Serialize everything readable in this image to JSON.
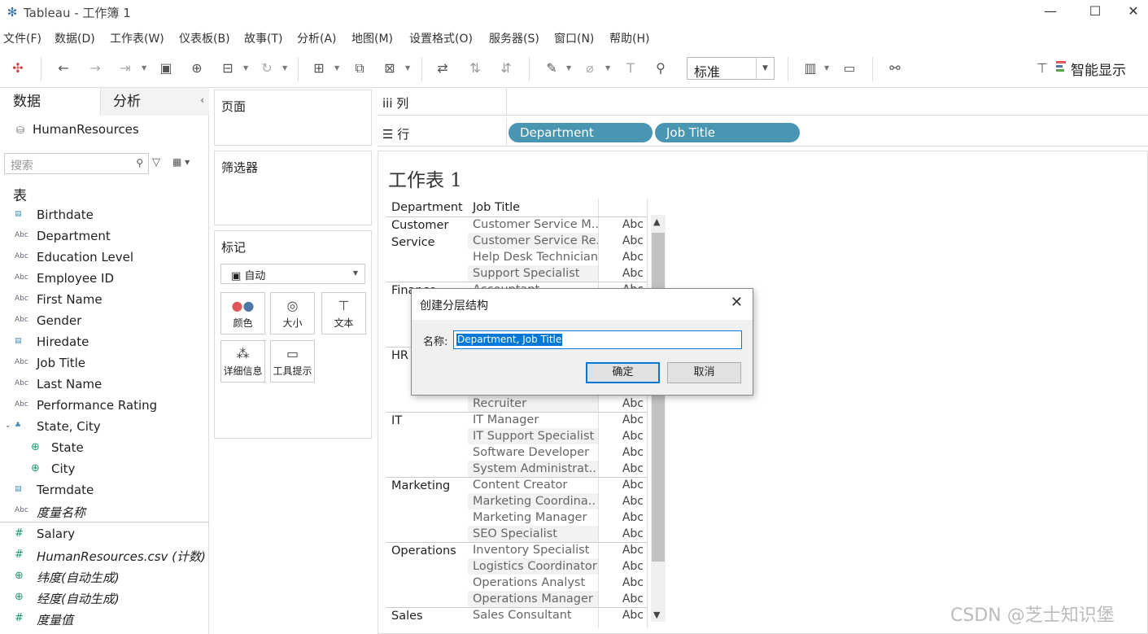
{
  "window": {
    "title": "Tableau - 工作簿 1",
    "minimize": "—",
    "maximize": "☐",
    "close": "✕"
  },
  "menu": [
    "文件(F)",
    "数据(D)",
    "工作表(W)",
    "仪表板(B)",
    "故事(T)",
    "分析(A)",
    "地图(M)",
    "设置格式(O)",
    "服务器(S)",
    "窗口(N)",
    "帮助(H)"
  ],
  "toolbar": {
    "fit_value": "标准",
    "smart_show": "智能显示"
  },
  "left_panel": {
    "tab_data": "数据",
    "tab_analysis": "分析",
    "datasource": "HumanResources",
    "search_placeholder": "搜索",
    "tables_header": "表",
    "fields": [
      {
        "label": "Birthdate",
        "type": "date"
      },
      {
        "label": "Department",
        "type": "string"
      },
      {
        "label": "Education Level",
        "type": "string"
      },
      {
        "label": "Employee ID",
        "type": "string"
      },
      {
        "label": "First Name",
        "type": "string"
      },
      {
        "label": "Gender",
        "type": "string"
      },
      {
        "label": "Hiredate",
        "type": "date"
      },
      {
        "label": "Job Title",
        "type": "string"
      },
      {
        "label": "Last Name",
        "type": "string"
      },
      {
        "label": "Performance Rating",
        "type": "string"
      },
      {
        "label": "State, City",
        "type": "hierarchy"
      },
      {
        "label": "State",
        "type": "geo"
      },
      {
        "label": "City",
        "type": "geo"
      },
      {
        "label": "Termdate",
        "type": "date"
      },
      {
        "label": "度量名称",
        "type": "string"
      }
    ],
    "measures": [
      {
        "label": "Salary",
        "type": "number"
      },
      {
        "label": "HumanResources.csv (计数)",
        "type": "number"
      },
      {
        "label": "纬度(自动生成)",
        "type": "geo"
      },
      {
        "label": "经度(自动生成)",
        "type": "geo"
      },
      {
        "label": "度量值",
        "type": "number"
      }
    ]
  },
  "cards": {
    "pages": "页面",
    "filters": "筛选器",
    "marks": "标记",
    "mark_type": "自动",
    "buttons": [
      "颜色",
      "大小",
      "文本",
      "详细信息",
      "工具提示"
    ]
  },
  "shelves": {
    "columns_label": "列",
    "rows_label": "行",
    "row_pills": [
      "Department",
      "Job Title"
    ]
  },
  "sheet": {
    "title": "工作表 1",
    "col_headers": [
      "Department",
      "Job Title"
    ],
    "cell_value": "Abc",
    "groups": [
      {
        "dept": "Customer Service",
        "jobs": [
          "Customer Service M..",
          "Customer Service Re..",
          "Help Desk Technician",
          "Support Specialist"
        ]
      },
      {
        "dept": "Finance",
        "jobs": [
          "Accountant",
          "",
          "",
          ""
        ]
      },
      {
        "dept": "HR",
        "jobs": [
          "",
          "",
          "",
          "Recruiter"
        ]
      },
      {
        "dept": "IT",
        "jobs": [
          "IT Manager",
          "IT Support Specialist",
          "Software Developer",
          "System Administrat.."
        ]
      },
      {
        "dept": "Marketing",
        "jobs": [
          "Content Creator",
          "Marketing Coordina..",
          "Marketing Manager",
          "SEO Specialist"
        ]
      },
      {
        "dept": "Operations",
        "jobs": [
          "Inventory Specialist",
          "Logistics Coordinator",
          "Operations Analyst",
          "Operations Manager"
        ]
      },
      {
        "dept": "Sales",
        "jobs": [
          "Sales Consultant"
        ]
      }
    ]
  },
  "dialog": {
    "title": "创建分层结构",
    "name_label": "名称:",
    "name_value": "Department, Job Title",
    "ok": "确定",
    "cancel": "取消"
  },
  "watermark": "CSDN @芝士知识堡"
}
